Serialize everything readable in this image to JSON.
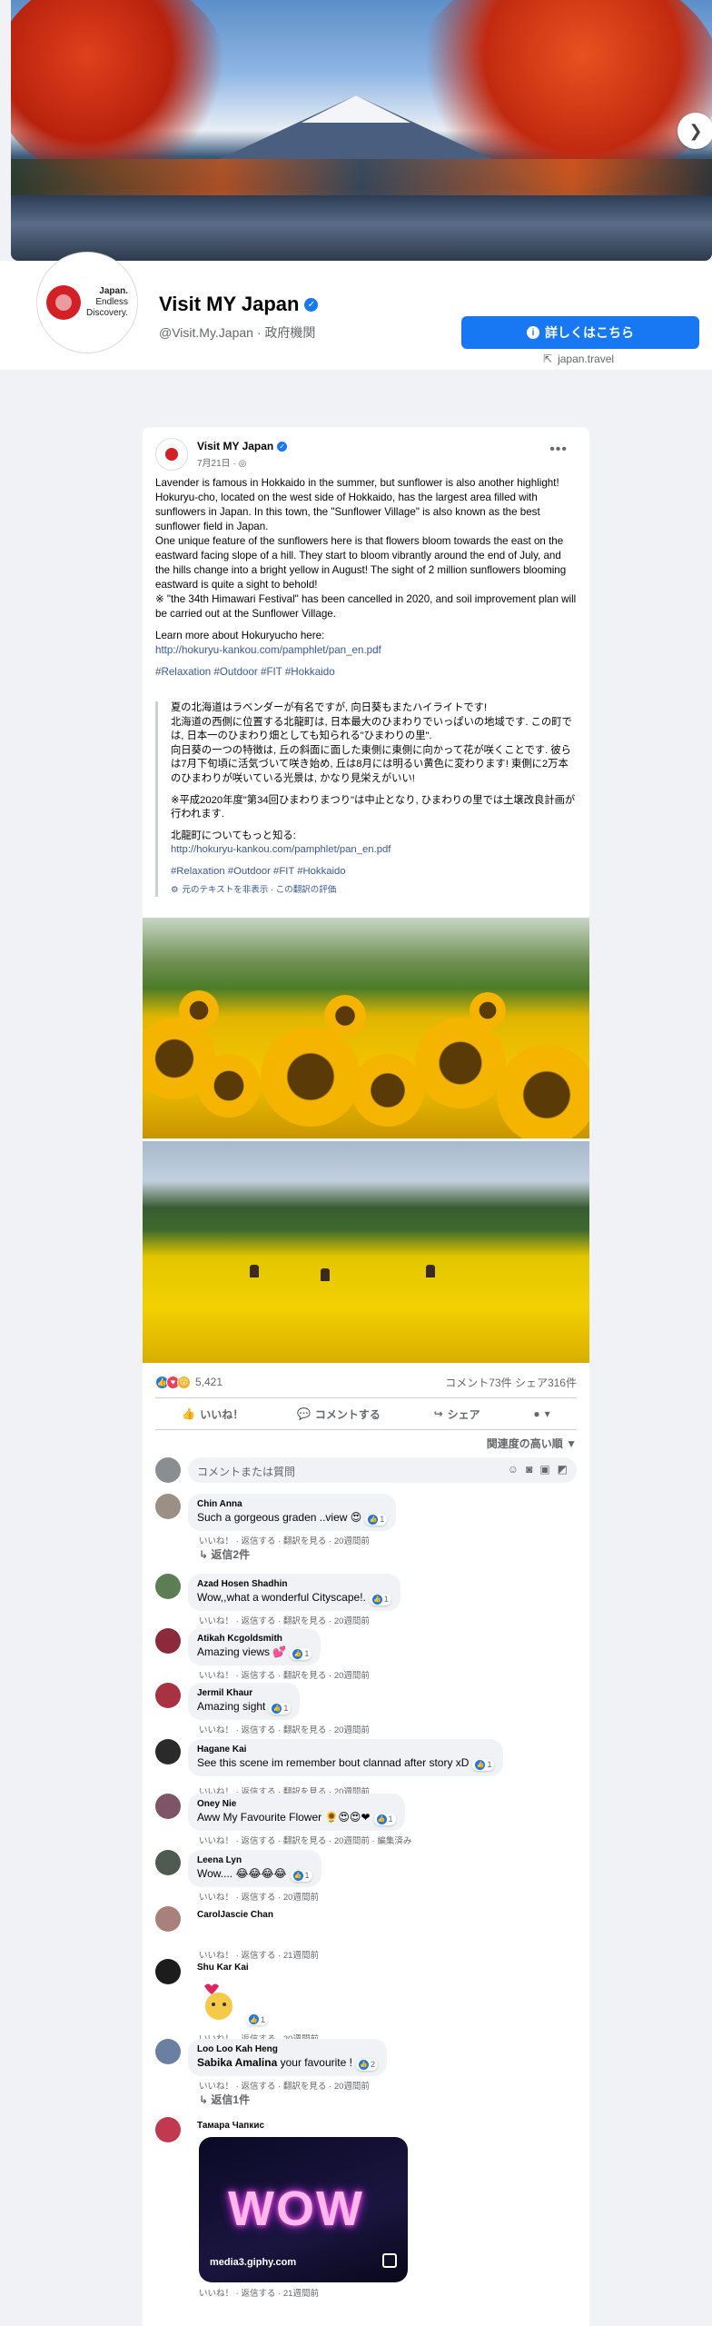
{
  "page": {
    "name": "Visit MY Japan",
    "handle": "@Visit.My.Japan · 政府機関",
    "cta_label": "詳しくはこちら",
    "site": "japan.travel",
    "logo_text": [
      "Japan.",
      "Endless",
      "Discovery."
    ]
  },
  "post": {
    "author": "Visit MY Japan",
    "date": "7月21日 · ",
    "en": {
      "p1": "Lavender is famous in Hokkaido in the summer, but sunflower is also another highlight!",
      "p2": "Hokuryu-cho, located on the west side of Hokkaido, has the largest area filled with sunflowers in Japan. In this town, the \"Sunflower Village\" is also known as the best sunflower field in Japan.",
      "p3": "One unique feature of the sunflowers here is that flowers bloom towards the east on the eastward facing slope of a hill. They start to bloom vibrantly around the end of July, and the hills change into a bright yellow in August! The sight of 2 million sunflowers blooming eastward is quite a sight to behold!",
      "p4": "※ \"the 34th Himawari Festival\" has been cancelled in 2020, and soil improvement plan will be carried out at the Sunflower Village.",
      "p5": "Learn more about Hokuryucho here:",
      "url": "http://hokuryu-kankou.com/pamphlet/pan_en.pdf",
      "tags": "#Relaxation #Outdoor #FIT #Hokkaido"
    },
    "ja": {
      "p1": "夏の北海道はラベンダーが有名ですが, 向日葵もまたハイライトです!",
      "p2": "北海道の西側に位置する北龍町は, 日本最大のひまわりでいっぱいの地域です. この町では, 日本一のひまわり畑としても知られる\"ひまわりの里\".",
      "p3": "向日葵の一つの特徴は, 丘の斜面に面した東側に東側に向かって花が咲くことです. 彼らは7月下旬頃に活気づいて咲き始め, 丘は8月には明るい黄色に変わります! 東側に2万本のひまわりが咲いている光景は, かなり見栄えがいい!",
      "p4": "※平成2020年度\"第34回ひまわりまつり\"は中止となり, ひまわりの里では土壌改良計画が行われます.",
      "p5": "北龍町についてもっと知る:",
      "url": "http://hokuryu-kankou.com/pamphlet/pan_en.pdf",
      "tags": "#Relaxation #Outdoor #FIT #Hokkaido",
      "toggle": "元のテキストを非表示 · この翻訳の評価"
    },
    "reactions_count": "5,421",
    "comments_shares": "コメント73件  シェア316件",
    "actions": {
      "like": "いいね！",
      "comment": "コメントする",
      "share": "シェア"
    },
    "sort_label": "関連度の高い順",
    "composer_placeholder": "コメントまたは質問"
  },
  "comments": [
    {
      "name": "Chin Anna",
      "text": "Such a gorgeous graden ..view 😍",
      "react": "1",
      "meta": "いいね！ · 返信する · 翻訳を見る · 20週間前",
      "replies": "返信2件"
    },
    {
      "name": "Azad Hosen Shadhin",
      "text": "Wow,,what a wonderful Cityscape!.",
      "react": "1",
      "meta": "いいね！ · 返信する · 翻訳を見る · 20週間前"
    },
    {
      "name": "Atikah Kcgoldsmith",
      "text": "Amazing views 💕",
      "react": "1",
      "meta": "いいね！ · 返信する · 翻訳を見る · 20週間前"
    },
    {
      "name": "Jermil Khaur",
      "text": "Amazing sight",
      "react": "1",
      "meta": "いいね！ · 返信する · 翻訳を見る · 20週間前"
    },
    {
      "name": "Hagane Kai",
      "text": "See this scene im remember bout clannad after story xD",
      "react": "1",
      "meta": "いいね！ · 返信する · 翻訳を見る · 20週間前"
    },
    {
      "name": "Oney Nie",
      "text": "Aww My Favourite Flower 🌻😍😍❤",
      "react": "1",
      "meta": "いいね！ · 返信する · 翻訳を見る · 20週間前 · 編集済み"
    },
    {
      "name": "Leena Lyn",
      "text": "Wow.... 😂😂😂😂",
      "react": "1",
      "meta": "いいね！ · 返信する · 20週間前"
    },
    {
      "name": "CarolJascie Chan",
      "text": "",
      "react": "",
      "meta": "いいね！ · 返信する · 21週間前"
    },
    {
      "name": "Shu Kar Kai",
      "text": "",
      "react": "1",
      "meta": "いいね！ · 返信する · 20週間前"
    },
    {
      "name": "Loo Loo Kah Heng",
      "text_bold": "Sabika Amalina",
      "text": " your favourite !",
      "react": "2",
      "meta": "いいね！ · 返信する · 翻訳を見る · 20週間前",
      "replies": "返信1件"
    },
    {
      "name": "Тамара Чапкис",
      "gif_source": "media3.giphy.com",
      "gif_text": "WOW",
      "meta": "いいね！ · 返信する · 21週間前"
    }
  ],
  "colors": {
    "brand_blue": "#1877f2",
    "link": "#385898",
    "muted": "#65676b"
  }
}
